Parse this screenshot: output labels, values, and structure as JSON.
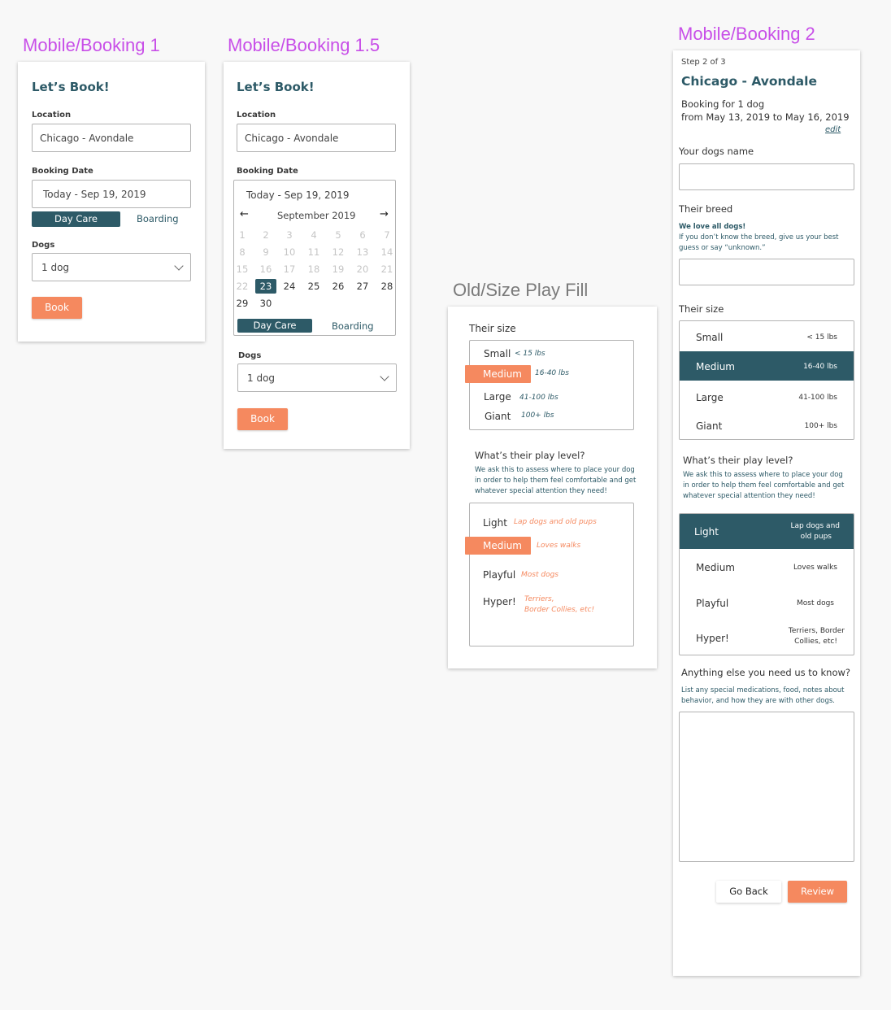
{
  "colors": {
    "teal": "#2d5a67",
    "orange": "#f5895f",
    "label_purple": "#c84fe8",
    "label_gray": "#7a7a7a"
  },
  "frames": {
    "booking1": "Mobile/Booking 1",
    "booking15": "Mobile/Booking 1.5",
    "sizeplay": "Old/Size Play Fill",
    "booking2": "Mobile/Booking 2"
  },
  "booking1": {
    "title": "Let’s Book!",
    "location_label": "Location",
    "location_value": "Chicago - Avondale",
    "date_label": "Booking Date",
    "date_value": "Today - Sep 19, 2019",
    "daycare": "Day Care",
    "boarding": "Boarding",
    "dogs_label": "Dogs",
    "dogs_value": "1 dog",
    "book": "Book"
  },
  "booking15": {
    "title": "Let’s Book!",
    "location_label": "Location",
    "location_value": "Chicago - Avondale",
    "date_label": "Booking Date",
    "date_value": "Today - Sep 19, 2019",
    "prev_arrow": "←",
    "next_arrow": "→",
    "month": "September 2019",
    "days": {
      "d1": "1",
      "d2": "2",
      "d3": "3",
      "d4": "4",
      "d5": "5",
      "d6": "6",
      "d7": "7",
      "d8": "8",
      "d9": "9",
      "d10": "10",
      "d11": "11",
      "d12": "12",
      "d13": "13",
      "d14": "14",
      "d15": "15",
      "d16": "16",
      "d17": "17",
      "d18": "18",
      "d19": "19",
      "d20": "20",
      "d21": "21",
      "d22": "22",
      "d23": "23",
      "d24": "24",
      "d25": "25",
      "d26": "26",
      "d27": "27",
      "d28": "28",
      "d29": "29",
      "d30": "30"
    },
    "selected_day": "23",
    "daycare": "Day Care",
    "boarding": "Boarding",
    "dogs_label": "Dogs",
    "dogs_value": "1 dog",
    "book": "Book"
  },
  "sizeplay": {
    "size_heading": "Their size",
    "sizes": [
      {
        "name": "Small",
        "note": "< 15 lbs"
      },
      {
        "name": "Medium",
        "note": "16-40 lbs"
      },
      {
        "name": "Large",
        "note": "41-100 lbs"
      },
      {
        "name": "Giant",
        "note": "100+ lbs"
      }
    ],
    "play_heading": "What’s their play level?",
    "play_desc": "We ask this to assess where to place your dog in order to help them feel comfortable and get whatever special attention they need!",
    "plays": [
      {
        "name": "Light",
        "note": "Lap dogs and old pups"
      },
      {
        "name": "Medium",
        "note": "Loves walks"
      },
      {
        "name": "Playful",
        "note": "Most dogs"
      },
      {
        "name": "Hyper!",
        "note1": "Terriers,",
        "note2": "Border Collies, etc!"
      }
    ]
  },
  "booking2": {
    "step": "Step 2 of 3",
    "title": "Chicago - Avondale",
    "booking_for": "Booking for 1 dog",
    "dates": "from May 13, 2019 to May 16, 2019",
    "edit": "edit",
    "name_label": "Your dogs name",
    "name_value": "",
    "breed_label": "Their breed",
    "breed_hint_bold": "We love all dogs!",
    "breed_hint": "If you don’t know the breed, give us your best guess or say “unknown.”",
    "breed_value": "",
    "size_label": "Their size",
    "sizes": [
      {
        "name": "Small",
        "note": "< 15 lbs"
      },
      {
        "name": "Medium",
        "note": "16-40 lbs"
      },
      {
        "name": "Large",
        "note": "41-100 lbs"
      },
      {
        "name": "Giant",
        "note": "100+ lbs"
      }
    ],
    "play_label": "What’s their play level?",
    "play_desc": "We ask this to assess where to place your dog in order to help them feel comfortable and get whatever special attention they need!",
    "plays": [
      {
        "name": "Light",
        "note1": "Lap dogs and",
        "note2": "old pups"
      },
      {
        "name": "Medium",
        "note1": "Loves walks"
      },
      {
        "name": "Playful",
        "note1": "Most dogs"
      },
      {
        "name": "Hyper!",
        "note1": "Terriers, Border",
        "note2": "Collies, etc!"
      }
    ],
    "else_label": "Anything else you need us to know?",
    "else_desc": "List any special medications, food, notes about behavior, and how they are with other dogs.",
    "else_value": "",
    "go_back": "Go Back",
    "review": "Review"
  }
}
